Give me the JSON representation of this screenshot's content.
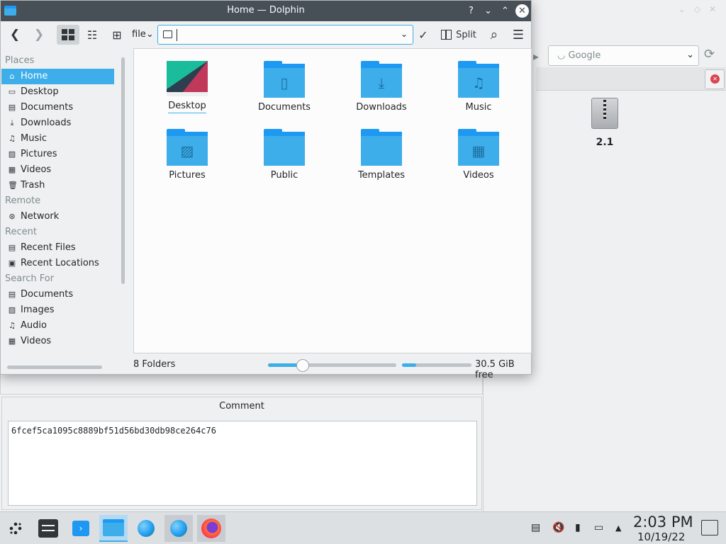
{
  "window": {
    "title": "Home — Dolphin",
    "help_glyph": "?",
    "minimize_glyph": "⌄",
    "maximize_glyph": "⌃",
    "close_glyph": "✕"
  },
  "toolbar": {
    "back_glyph": "❮",
    "forward_glyph": "❯",
    "scheme_label": "file",
    "scheme_arrow": "⌄",
    "location_value": "",
    "location_arrow": "⌄",
    "accept_glyph": "✓",
    "split_label": "Split",
    "search_glyph": "⌕",
    "menu_glyph": "☰"
  },
  "sidebar": {
    "sections": [
      {
        "title": "Places",
        "items": [
          {
            "label": "Home",
            "icon": "home-icon",
            "glyph": "⌂",
            "active": true
          },
          {
            "label": "Desktop",
            "icon": "desktop-icon",
            "glyph": "▭"
          },
          {
            "label": "Documents",
            "icon": "documents-icon",
            "glyph": "▤"
          },
          {
            "label": "Downloads",
            "icon": "downloads-icon",
            "glyph": "⤓"
          },
          {
            "label": "Music",
            "icon": "music-icon",
            "glyph": "♫"
          },
          {
            "label": "Pictures",
            "icon": "pictures-icon",
            "glyph": "▨"
          },
          {
            "label": "Videos",
            "icon": "videos-icon",
            "glyph": "▦"
          },
          {
            "label": "Trash",
            "icon": "trash-icon",
            "glyph": "🗑"
          }
        ]
      },
      {
        "title": "Remote",
        "items": [
          {
            "label": "Network",
            "icon": "network-icon",
            "glyph": "⊛"
          }
        ]
      },
      {
        "title": "Recent",
        "items": [
          {
            "label": "Recent Files",
            "icon": "recent-files-icon",
            "glyph": "▤"
          },
          {
            "label": "Recent Locations",
            "icon": "recent-locations-icon",
            "glyph": "▣"
          }
        ]
      },
      {
        "title": "Search For",
        "items": [
          {
            "label": "Documents",
            "icon": "search-documents-icon",
            "glyph": "▤"
          },
          {
            "label": "Images",
            "icon": "search-images-icon",
            "glyph": "▨"
          },
          {
            "label": "Audio",
            "icon": "search-audio-icon",
            "glyph": "♫"
          },
          {
            "label": "Videos",
            "icon": "search-videos-icon",
            "glyph": "▦"
          }
        ]
      }
    ]
  },
  "folders": [
    {
      "label": "Desktop",
      "icon": "desktop-thumbnail-icon",
      "glyph": "",
      "selected": true
    },
    {
      "label": "Documents",
      "icon": "folder-documents-icon",
      "glyph": "▯"
    },
    {
      "label": "Downloads",
      "icon": "folder-downloads-icon",
      "glyph": "⤓"
    },
    {
      "label": "Music",
      "icon": "folder-music-icon",
      "glyph": "♫"
    },
    {
      "label": "Pictures",
      "icon": "folder-pictures-icon",
      "glyph": "▨"
    },
    {
      "label": "Public",
      "icon": "folder-public-icon",
      "glyph": ""
    },
    {
      "label": "Templates",
      "icon": "folder-templates-icon",
      "glyph": ""
    },
    {
      "label": "Videos",
      "icon": "folder-videos-icon",
      "glyph": "▦"
    }
  ],
  "statusbar": {
    "summary": "8 Folders",
    "zoom_fraction": 0.27,
    "space_used_fraction": 0.2,
    "space_free": "30.5 GiB free"
  },
  "background_window": {
    "search_engine": "Google",
    "search_engine_glyph": "◡",
    "dropdown_glyph": "⌄",
    "reload_glyph": "⟳",
    "file_label": "2.1",
    "comment_title": "Comment",
    "comment_value": "6fcef5ca1095c8889bf51d56bd30db98ce264c76"
  },
  "taskbar": {
    "clock_time": "2:03 PM",
    "clock_date": "10/19/22"
  },
  "colors": {
    "accent": "#3daee9",
    "folder_blue": "#1d99f3",
    "titlebar": "#475057"
  }
}
